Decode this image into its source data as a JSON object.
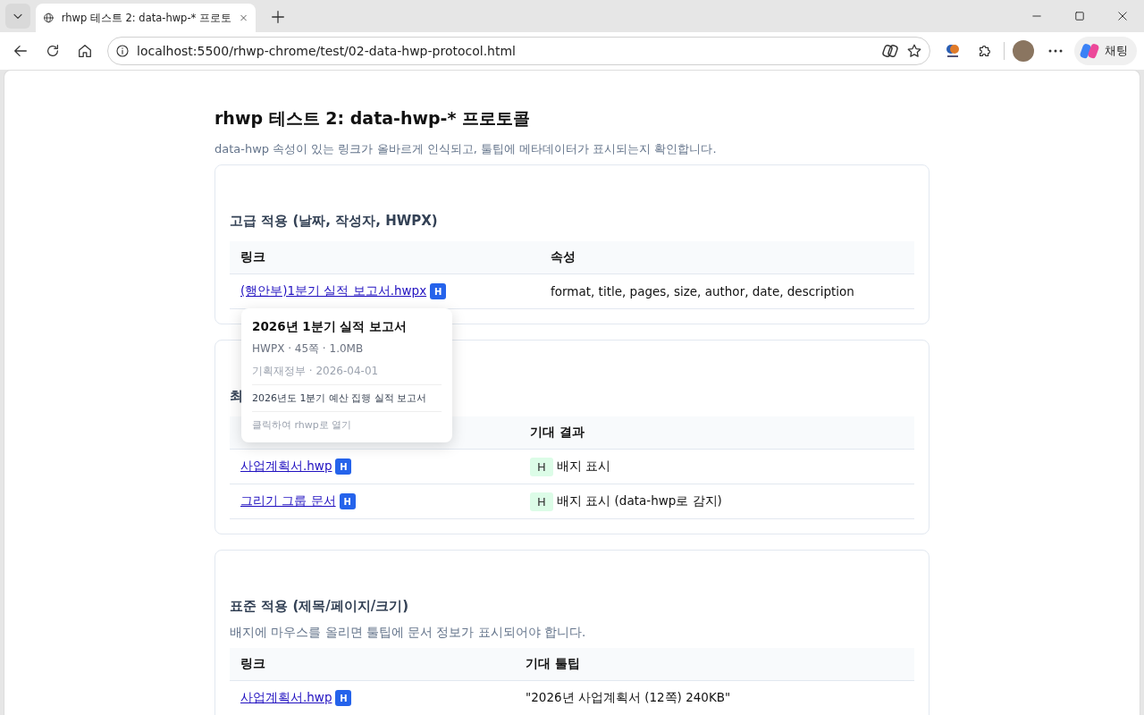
{
  "browser": {
    "tab": {
      "title": "rhwp 테스트 2: data-hwp-* 프로토"
    },
    "address": "localhost:5500/rhwp-chrome/test/02-data-hwp-protocol.html",
    "chat_button": "채팅"
  },
  "page": {
    "title": "rhwp 테스트 2: data-hwp-* 프로토콜",
    "intro": "data-hwp 속성이 있는 링크가 올바르게 인식되고, 툴팁에 메타데이터가 표시되는지 확인합니다.",
    "sections": [
      {
        "heading": "고급 적용 (날짜, 작성자, HWPX)",
        "columns": [
          "링크",
          "속성"
        ],
        "rows": [
          {
            "link": "(행안부)1분기 실적 보고서.hwpx",
            "badge": "H",
            "value": "format, title, pages, size, author, date, description"
          }
        ]
      },
      {
        "heading": "최",
        "columns": [
          "기대 결과"
        ],
        "rows": [
          {
            "link": "사업계획서.hwp",
            "badge": "H",
            "chip": "H",
            "value": "배지 표시"
          },
          {
            "link": "그리기 그룹 문서",
            "badge": "H",
            "chip": "H",
            "value": "배지 표시 (data-hwp로 감지)"
          }
        ]
      },
      {
        "heading": "표준 적용 (제목/페이지/크기)",
        "description": "배지에 마우스를 올리면 툴팁에 문서 정보가 표시되어야 합니다.",
        "columns": [
          "링크",
          "기대 툴팁"
        ],
        "rows": [
          {
            "link": "사업계획서.hwp",
            "badge": "H",
            "value": "\"2026년 사업계획서 (12쪽) 240KB\""
          }
        ]
      }
    ]
  },
  "tooltip": {
    "title": "2026년 1분기 실적 보고서",
    "meta": "HWPX · 45쪽 · 1.0MB",
    "author_date": "기획재정부 · 2026-04-01",
    "description": "2026년도 1분기 예산 집행 실적 보고서",
    "hint": "클릭하여 rhwp로 열기"
  }
}
